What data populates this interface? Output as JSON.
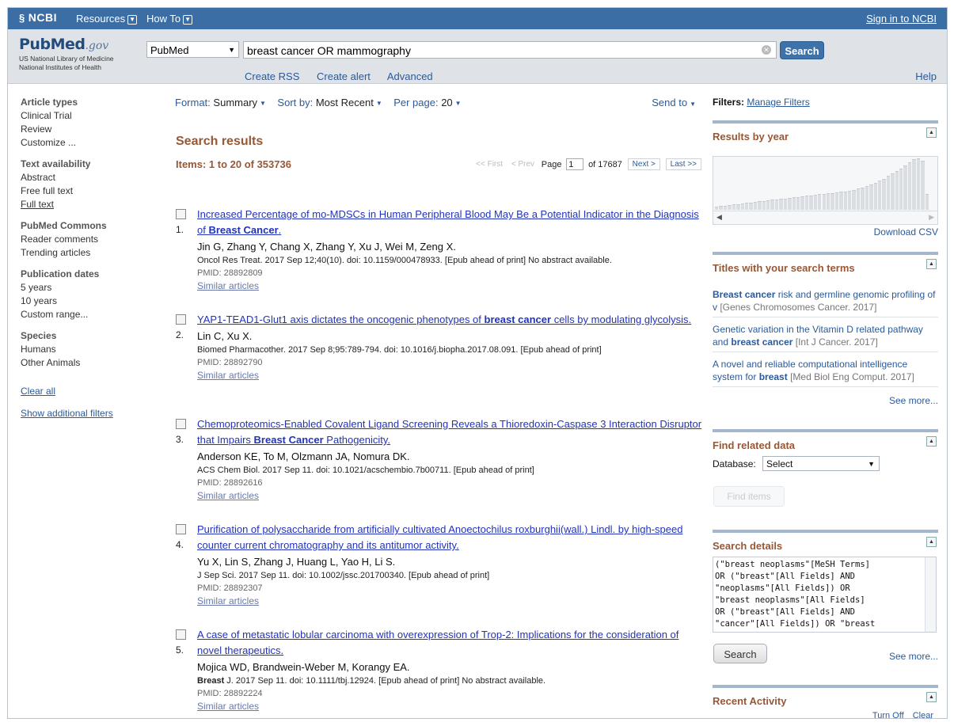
{
  "topbar": {
    "brand": "NCBI",
    "resources": "Resources",
    "howto": "How To",
    "signin": "Sign in to NCBI"
  },
  "header": {
    "logo_pub": "Pub",
    "logo_med": "Med",
    "logo_gov": ".gov",
    "logo_line1": "US National Library of Medicine",
    "logo_line2": "National Institutes of Health",
    "database": "PubMed",
    "query": "breast cancer OR mammography",
    "search_label": "Search",
    "links": [
      "Create RSS",
      "Create alert",
      "Advanced"
    ],
    "help": "Help"
  },
  "sidebar": {
    "groups": [
      {
        "title": "Article types",
        "items": [
          "Clinical Trial",
          "Review",
          "Customize ..."
        ]
      },
      {
        "title": "Text availability",
        "items": [
          "Abstract",
          "Free full text",
          "Full text"
        ]
      },
      {
        "title": "PubMed Commons",
        "items": [
          "Reader comments",
          "Trending articles"
        ]
      },
      {
        "title": "Publication dates",
        "items": [
          "5 years",
          "10 years",
          "Custom range..."
        ]
      },
      {
        "title": "Species",
        "items": [
          "Humans",
          "Other Animals"
        ]
      }
    ],
    "clear_all": "Clear all",
    "show_more": "Show additional filters"
  },
  "toolbar": {
    "format_label": "Format:",
    "format_value": "Summary",
    "sort_label": "Sort by:",
    "sort_value": "Most Recent",
    "perpage_label": "Per page:",
    "perpage_value": "20",
    "send_to": "Send to"
  },
  "results": {
    "heading": "Search results",
    "count": "Items: 1 to 20 of 353736",
    "pager": {
      "first": "<< First",
      "prev": "< Prev",
      "page_label": "Page",
      "page": "1",
      "of": "of 17687",
      "next": "Next >",
      "last": "Last >>"
    },
    "items": [
      {
        "num": "1.",
        "title_before": "Increased Percentage of mo-MDSCs in Human Peripheral Blood May Be a Potential Indicator in the Diagnosis of ",
        "title_bold": "Breast Cancer",
        "title_after": ".",
        "authors": "Jin G, Zhang Y, Chang X, Zhang Y, Xu J, Wei M, Zeng X.",
        "cite_bold": "",
        "cite": "Oncol Res Treat. 2017 Sep 12;40(10). doi: 10.1159/000478933. [Epub ahead of print] No abstract available.",
        "pmid": "PMID: 28892809",
        "similar": "Similar articles"
      },
      {
        "num": "2.",
        "title_before": "YAP1-TEAD1-Glut1 axis dictates the oncogenic phenotypes of ",
        "title_bold": "breast cancer",
        "title_after": " cells by modulating glycolysis.",
        "authors": "Lin C, Xu X.",
        "cite_bold": "",
        "cite": "Biomed Pharmacother. 2017 Sep 8;95:789-794. doi: 10.1016/j.biopha.2017.08.091. [Epub ahead of print]",
        "pmid": "PMID: 28892790",
        "similar": "Similar articles"
      },
      {
        "num": "3.",
        "title_before": "Chemoproteomics-Enabled Covalent Ligand Screening Reveals a Thioredoxin-Caspase 3 Interaction Disruptor that Impairs ",
        "title_bold": "Breast Cancer",
        "title_after": " Pathogenicity.",
        "authors": "Anderson KE, To M, Olzmann JA, Nomura DK.",
        "cite_bold": "",
        "cite": "ACS Chem Biol. 2017 Sep 11. doi: 10.1021/acschembio.7b00711. [Epub ahead of print]",
        "pmid": "PMID: 28892616",
        "similar": "Similar articles"
      },
      {
        "num": "4.",
        "title_before": "Purification of polysaccharide from artificially cultivated Anoectochilus roxburghii(wall.) Lindl. by high-speed counter current chromatography and its antitumor activity.",
        "title_bold": "",
        "title_after": "",
        "authors": "Yu X, Lin S, Zhang J, Huang L, Yao H, Li S.",
        "cite_bold": "",
        "cite": "J Sep Sci. 2017 Sep 11. doi: 10.1002/jssc.201700340. [Epub ahead of print]",
        "pmid": "PMID: 28892307",
        "similar": "Similar articles"
      },
      {
        "num": "5.",
        "title_before": "A case of metastatic lobular carcinoma with overexpression of Trop-2: Implications for the consideration of novel therapeutics.",
        "title_bold": "",
        "title_after": "",
        "authors": "Mojica WD, Brandwein-Weber M, Korangy EA.",
        "cite_bold": "Breast",
        "cite": " J. 2017 Sep 11. doi: 10.1111/tbj.12924. [Epub ahead of print] No abstract available.",
        "pmid": "PMID: 28892224",
        "similar": "Similar articles"
      }
    ]
  },
  "right": {
    "filters_label": "Filters:",
    "manage_filters": "Manage Filters",
    "by_year": {
      "title": "Results by year",
      "download": "Download CSV",
      "relative_counts": [
        0.05,
        0.06,
        0.07,
        0.08,
        0.09,
        0.1,
        0.11,
        0.12,
        0.13,
        0.14,
        0.15,
        0.16,
        0.17,
        0.18,
        0.19,
        0.2,
        0.21,
        0.22,
        0.23,
        0.24,
        0.25,
        0.26,
        0.27,
        0.28,
        0.29,
        0.3,
        0.31,
        0.32,
        0.33,
        0.34,
        0.35,
        0.36,
        0.38,
        0.4,
        0.42,
        0.45,
        0.48,
        0.52,
        0.56,
        0.6,
        0.65,
        0.7,
        0.75,
        0.8,
        0.86,
        0.92,
        0.98,
        1.0,
        0.96,
        0.3
      ]
    },
    "titles_panel": {
      "title": "Titles with your search terms",
      "items": [
        {
          "bold": "Breast cancer",
          "text": " risk and germline genomic profiling of v",
          "src": "[Genes Chromosomes Cancer. 2017]"
        },
        {
          "bold": "",
          "text": "Genetic variation in the Vitamin D related pathway and ",
          "bold2": "breast cancer",
          "text2": " ",
          "src": "[Int J Cancer. 2017]"
        },
        {
          "bold": "",
          "text": "A novel and reliable computational intelligence system for ",
          "bold2": "breast",
          "text2": " ",
          "src": "[Med Biol Eng Comput. 2017]"
        }
      ],
      "see_more": "See more..."
    },
    "related": {
      "title": "Find related data",
      "db_label": "Database:",
      "db_value": "Select",
      "find_btn": "Find items"
    },
    "details": {
      "title": "Search details",
      "query": "(\"breast neoplasms\"[MeSH Terms]\nOR (\"breast\"[All Fields] AND\n\"neoplasms\"[All Fields]) OR\n\"breast neoplasms\"[All Fields]\nOR (\"breast\"[All Fields] AND\n\"cancer\"[All Fields]) OR \"breast",
      "search_btn": "Search",
      "see_more": "See more..."
    },
    "recent": {
      "title": "Recent Activity",
      "turn_off": "Turn Off",
      "clear": "Clear"
    }
  }
}
